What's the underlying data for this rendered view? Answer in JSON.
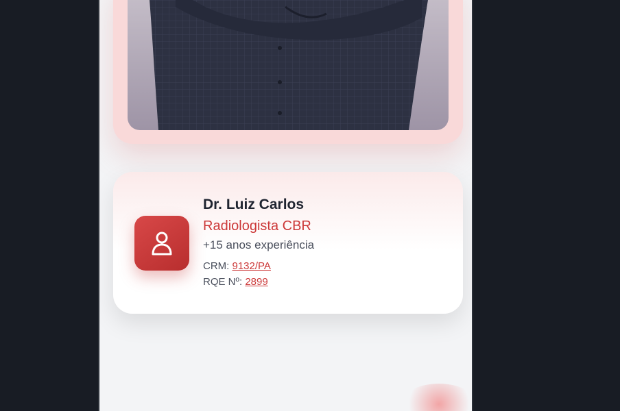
{
  "doctor": {
    "name": "Dr. Luiz Carlos",
    "specialty": "Radiologista CBR",
    "experience": "+15 anos experiência",
    "crm_label": "CRM: ",
    "crm_value": "9132/PA",
    "rqe_label": "RQE Nº: ",
    "rqe_value": "2899"
  },
  "icons": {
    "avatar": "user-icon"
  },
  "colors": {
    "accent": "#cc3838",
    "background": "#181c24",
    "card": "#ffffff"
  }
}
